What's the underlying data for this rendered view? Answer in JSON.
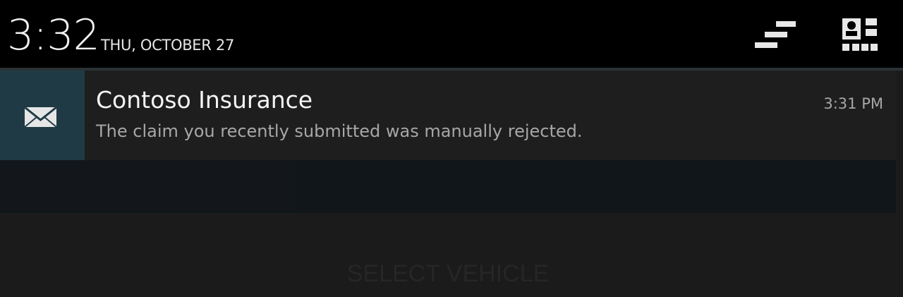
{
  "status": {
    "time": "3:32",
    "date": "THU, OCTOBER 27",
    "clear_icon": "clear-all-icon",
    "settings_icon": "quick-settings-icon"
  },
  "notification": {
    "icon": "envelope-icon",
    "title": "Contoso Insurance",
    "text": "The claim you recently submitted was manually rejected.",
    "time": "3:31 PM"
  },
  "background_app": {
    "select_vehicle_label": "SELECT VEHICLE"
  }
}
